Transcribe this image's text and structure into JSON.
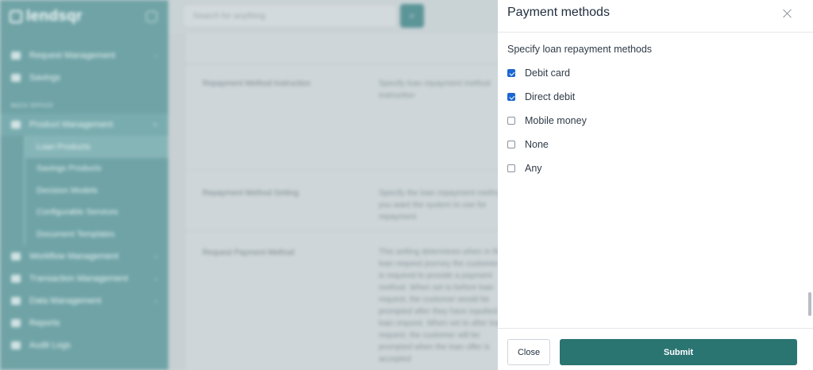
{
  "app": {
    "logo_text": "lendsqr"
  },
  "sidebar": {
    "top_items": [
      {
        "label": "Request Management",
        "icon": "chart-icon"
      },
      {
        "label": "Savings",
        "icon": "piggy-bank-icon"
      }
    ],
    "section_label": "BACK OFFICE",
    "product_management": {
      "label": "Product Management",
      "icon": "box-icon"
    },
    "sub_items": [
      {
        "label": "Loan Products",
        "active": true
      },
      {
        "label": "Savings Products"
      },
      {
        "label": "Decision Models"
      },
      {
        "label": "Configurable Services"
      },
      {
        "label": "Document Templates"
      }
    ],
    "bottom_items": [
      {
        "label": "Workflow Management",
        "icon": "workflow-icon"
      },
      {
        "label": "Transaction Management",
        "icon": "transaction-icon"
      },
      {
        "label": "Data Management",
        "icon": "data-icon"
      },
      {
        "label": "Reports",
        "icon": "report-icon"
      },
      {
        "label": "Audit Logs",
        "icon": "audit-icon"
      }
    ]
  },
  "topbar": {
    "search_placeholder": "Search for anything"
  },
  "background_rows": [
    {
      "label": "Repayment Method Instruction",
      "desc": "Specify loan repayment method instruction"
    },
    {
      "label": "Repayment Method Setting",
      "desc": "Specify the loan repayment method you want the system to use for repayment"
    },
    {
      "label": "Request Payment Method",
      "desc": "This setting determines when in the loan request journey the customer is required to provide a payment method. When set to before loan request, the customer would be prompted after they have inputted loan request. When set to after loan request, the customer will be prompted when the loan offer is accepted"
    }
  ],
  "modal": {
    "title": "Payment methods",
    "subtitle": "Specify loan repayment methods",
    "options": [
      {
        "label": "Debit card",
        "checked": true
      },
      {
        "label": "Direct debit",
        "checked": true
      },
      {
        "label": "Mobile money",
        "checked": false
      },
      {
        "label": "None",
        "checked": false
      },
      {
        "label": "Any",
        "checked": false
      }
    ],
    "close_label": "Close",
    "submit_label": "Submit"
  },
  "colors": {
    "primary": "#2a7472",
    "checkbox_checked": "#1a66d2",
    "sidebar": "#6fa3a6"
  }
}
